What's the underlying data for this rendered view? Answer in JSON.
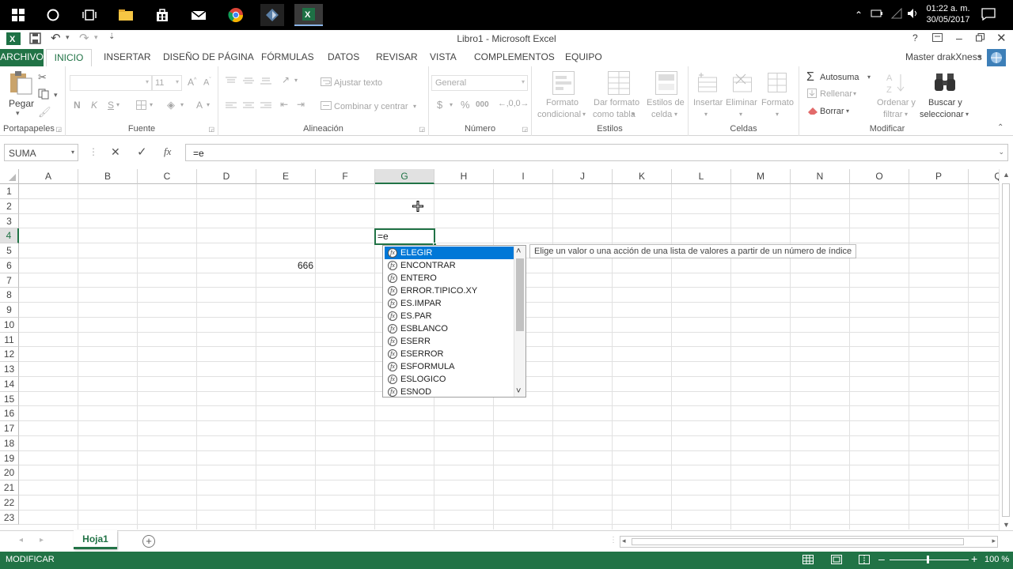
{
  "taskbar": {
    "time": "01:22 a. m.",
    "date": "30/05/2017",
    "apps": [
      "start-icon",
      "cortana-icon",
      "task-view-icon",
      "file-explorer-icon",
      "store-icon",
      "mail-icon",
      "chrome-icon",
      "app-icon",
      "excel-icon"
    ]
  },
  "title": {
    "window_title": "Libro1 - Microsoft Excel",
    "help": "?",
    "user": "Master drakXness"
  },
  "ribbon_tabs": [
    "ARCHIVO",
    "INICIO",
    "INSERTAR",
    "DISEÑO DE PÁGINA",
    "FÓRMULAS",
    "DATOS",
    "REVISAR",
    "VISTA",
    "COMPLEMENTOS",
    "EQUIPO"
  ],
  "ribbon": {
    "clipboard": {
      "paste": "Pegar",
      "label": "Portapapeles"
    },
    "font": {
      "size": "11",
      "bold": "N",
      "italic": "K",
      "underline": "S",
      "label": "Fuente"
    },
    "alignment": {
      "wrap": "Ajustar texto",
      "merge": "Combinar y centrar",
      "label": "Alineación"
    },
    "number": {
      "format": "General",
      "currency": "$",
      "percent": "%",
      "thousands": "000",
      "label": "Número"
    },
    "styles": {
      "conditional_1": "Formato",
      "conditional_2": "condicional",
      "table_1": "Dar formato",
      "table_2": "como tabla",
      "cell_1": "Estilos de",
      "cell_2": "celda",
      "label": "Estilos"
    },
    "cells": {
      "insert": "Insertar",
      "delete": "Eliminar",
      "format": "Formato",
      "label": "Celdas"
    },
    "editing": {
      "autosum": "Autosuma",
      "fill": "Rellenar",
      "clear": "Borrar",
      "sort_1": "Ordenar y",
      "sort_2": "filtrar",
      "find_1": "Buscar y",
      "find_2": "seleccionar",
      "label": "Modificar"
    }
  },
  "formula_bar": {
    "name_box": "SUMA",
    "fx": "fx",
    "content": "=e"
  },
  "columns": [
    "A",
    "B",
    "C",
    "D",
    "E",
    "F",
    "G",
    "H",
    "I",
    "J",
    "K",
    "L",
    "M",
    "N",
    "O",
    "P",
    "Q"
  ],
  "rows": [
    "1",
    "2",
    "3",
    "4",
    "5",
    "6",
    "7",
    "8",
    "9",
    "10",
    "11",
    "12",
    "13",
    "14",
    "15",
    "16",
    "17",
    "18",
    "19",
    "20",
    "21",
    "22",
    "23"
  ],
  "cells": {
    "e6": "666",
    "g4": "=e"
  },
  "autocomplete": {
    "items": [
      "ELEGIR",
      "ENCONTRAR",
      "ENTERO",
      "ERROR.TIPICO.XY",
      "ES.IMPAR",
      "ES.PAR",
      "ESBLANCO",
      "ESERR",
      "ESERROR",
      "ESFORMULA",
      "ESLOGICO",
      "ESNOD"
    ],
    "selected_index": 0,
    "tooltip": "Elige un valor o una acción de una lista de valores a partir de un número de índice"
  },
  "sheets": {
    "active": "Hoja1"
  },
  "status": {
    "mode": "MODIFICAR",
    "zoom": "100 %"
  },
  "colors": {
    "excel_green": "#217346",
    "selection_blue": "#0078d7"
  }
}
